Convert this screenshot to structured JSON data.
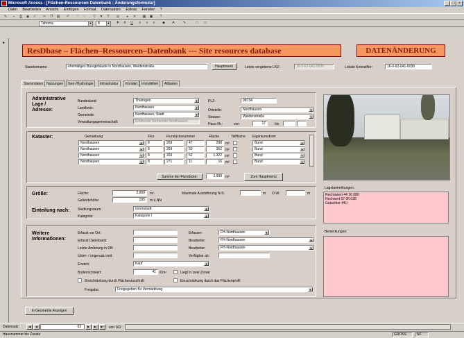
{
  "window": {
    "title": "Microsoft Access - [Flächen-Ressourcen Datenbank : Änderungsformular]",
    "min": "_",
    "max": "□",
    "close": "×"
  },
  "menu": [
    "Datei",
    "Bearbeiten",
    "Ansicht",
    "Einfügen",
    "Format",
    "Datensätze",
    "Extras",
    "Fenster",
    "?"
  ],
  "toolbar": {
    "font": "Tahoma",
    "size": "8",
    "bold": "F",
    "italic": "K",
    "underline": "U"
  },
  "header": {
    "title": "ResDbase – Flächen–Ressourcen–Datenbank --- Site resources database",
    "mode": "DATENÄNDERUNG"
  },
  "top": {
    "standort_label": "Standortname:",
    "standort_value": "ehemaliges Bürogebäude in Nordhausen, Weidenstraße",
    "hauptmenu": "Hauptmenü",
    "lk_label": "Letzte vergebene LKZ:",
    "lk_value": "16-0-62-041-0030",
    "lokal_label": "Lokale Kennziffer:",
    "lokal_value": "16-0-62-041-0030"
  },
  "tabs": [
    "Stammdaten",
    "Nutzungen",
    "Geo-/Hydrologie",
    "Infrastruktur",
    "Kontakt",
    "Immobilien",
    "Altlasten"
  ],
  "admin": {
    "title1": "Administrative",
    "title2": "Lage /",
    "title3": "Adresse:",
    "bundesland_label": "Bundesland:",
    "bundesland": "Thüringen",
    "landkreis_label": "Landkreis:",
    "landkreis": "Nordhausen",
    "gemeinde_label": "Gemeinde:",
    "gemeinde": "Nordhausen, Stadt",
    "vg_label": "Verwaltungsgemeinschaft:",
    "vg": "Erfüllende Gemeinde Nordhausen",
    "plz_label": "PLZ:",
    "plz": "99734",
    "ortsteile_label": "Ortsteile:",
    "ortsteile": "Nordhausen",
    "strasse_label": "Strasse:",
    "strasse": "Weidenstraße",
    "hausnr_label": "Haus-Nr.:",
    "von": "von",
    "hausnr": "17",
    "bis": "bis"
  },
  "kataster": {
    "title": "Kataster:",
    "headers": [
      "Gemarkung",
      "Flur",
      "Flurstücksnummer",
      "Fläche",
      "Teilfläche",
      "Eigentumsform"
    ],
    "rows": [
      {
        "gem": "Nordhausen",
        "flur": "8",
        "fs1": "269",
        "fs2": "47",
        "fl": "298",
        "ei": "Bund"
      },
      {
        "gem": "Nordhausen",
        "flur": "8",
        "fs1": "269",
        "fs2": "50",
        "fl": "362",
        "ei": "Bund"
      },
      {
        "gem": "Nordhausen",
        "flur": "8",
        "fs1": "269",
        "fs2": "52",
        "fl": "1.322",
        "ei": "Bund"
      },
      {
        "gem": "Nordhausen",
        "flur": "8",
        "fs1": "271",
        "fs2": "11",
        "fl": "16",
        "ei": "Bund"
      }
    ],
    "unit": "m²",
    "sum_label": "Summe der Flurstücke:",
    "sum": "2.999",
    "sum_unit": "m²",
    "zum": "Zum Hauptmenü"
  },
  "groesse": {
    "title": "Größe:",
    "flaeche_label": "Fläche:",
    "flaeche": "2.999",
    "flaeche_unit": "m²",
    "hoehe_label": "Geländehöhe:",
    "hoehe": "195",
    "hoehe_unit": "m ü.NN",
    "ausdehnung_label": "Maximale Ausdehnung N-S:",
    "ns_unit": "m",
    "ow_label": "O-W:",
    "ow_unit": "m"
  },
  "einteilung": {
    "title": "Einteilung nach:",
    "siedlung_label": "Siedlungsraum:",
    "siedlung": "Innenstadt",
    "kategorie_label": "Kategorie:",
    "kategorie": "Kategorie I"
  },
  "weitere": {
    "title1": "Weitere",
    "title2": "Informationen:",
    "erfasst_ort": "Erfasst vor Ort:",
    "erfasst_db": "Erfasst Datenbank:",
    "letzte": "Letzte Änderung in DB:",
    "unter": "Unter- / ungenutzt seit:",
    "erwerb_label": "Erwerb:",
    "erwerb": "Kauf",
    "bodenricht_label": "Bodenrichtwert:",
    "bodenricht": "41",
    "bodenricht_unit": "€/m²",
    "zonen": "Liegt in zwei Zonen",
    "einschr1": "Einschränkung durch Flächenzuschnitt",
    "einschr2": "Einschränkung durch das Flächenprofil",
    "freigabe_label": "Freigabe:",
    "freigabe": "Freigegeben für Vermarktung",
    "erfasser_label": "Erfasser:",
    "erfasser": "FH-Nordhausen",
    "bearb1_label": "Bearbeiter:",
    "bearb1": "FH-Nordhausen",
    "bearb2_label": "Bearbeiter:",
    "bearb2": "FH-Nordhausen",
    "verfueg_label": "Verfügbar ab:"
  },
  "right": {
    "lage_label": "Lagebemerkungen:",
    "lage": "Rechtswert 44 16 080\nHochwert 57 06 028\nGutachter IHU",
    "bem_label": "Bemerkungen:"
  },
  "geo_button": "In Geometrie Anzeigen",
  "status": {
    "datensatz": "Datensatz:",
    "current": "63",
    "total": "von 162",
    "hint": "Hausnummer bis Zusatz",
    "gross": "GROSS",
    "nf": "NF"
  },
  "colors": {
    "header_bg": "#f49860",
    "pink": "#ffc8cc"
  }
}
